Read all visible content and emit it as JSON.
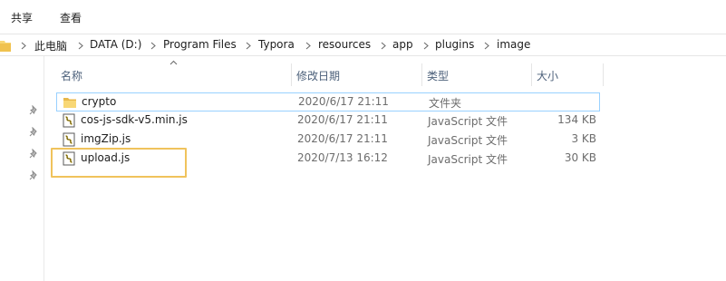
{
  "ribbon": {
    "tabs": [
      {
        "label": "共享"
      },
      {
        "label": "查看"
      }
    ]
  },
  "address": {
    "crumbs": [
      "此电脑",
      "DATA (D:)",
      "Program Files",
      "Typora",
      "resources",
      "app",
      "plugins",
      "image"
    ]
  },
  "columns": {
    "name": "名称",
    "date": "修改日期",
    "type": "类型",
    "size": "大小"
  },
  "files": [
    {
      "name": "crypto",
      "date": "2020/6/17 21:11",
      "type": "文件夹",
      "size": "",
      "icon": "folder-icon",
      "selected": true
    },
    {
      "name": "cos-js-sdk-v5.min.js",
      "date": "2020/6/17 21:11",
      "type": "JavaScript 文件",
      "size": "134 KB",
      "icon": "js-file-icon"
    },
    {
      "name": "imgZip.js",
      "date": "2020/6/17 21:11",
      "type": "JavaScript 文件",
      "size": "3 KB",
      "icon": "js-file-icon"
    },
    {
      "name": "upload.js",
      "date": "2020/7/13 16:12",
      "type": "JavaScript 文件",
      "size": "30 KB",
      "icon": "js-file-icon"
    }
  ],
  "colors": {
    "highlight": "#f0c35c",
    "selection_border": "#99d1ff",
    "header_text": "#4c607a",
    "folder_yellow": "#f8d775"
  }
}
